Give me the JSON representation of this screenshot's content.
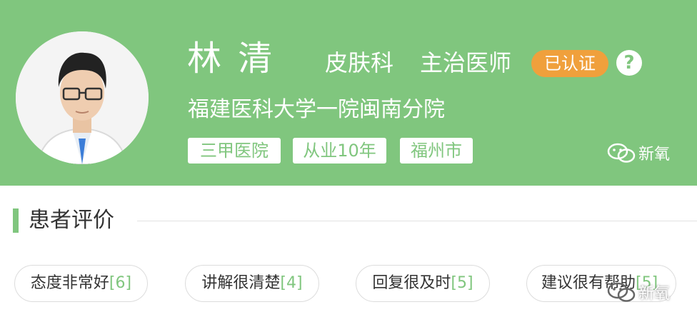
{
  "doctor": {
    "name": "林  清",
    "department": "皮肤科",
    "title": "主治医师",
    "verified_label": "已认证",
    "help_label": "?",
    "hospital": "福建医科大学一院闽南分院",
    "tags": [
      "三甲医院",
      "从业10年",
      "福州市"
    ]
  },
  "watermark": {
    "text": "新氧",
    "icon": "wechat-icon"
  },
  "reviews": {
    "section_title": "患者评价",
    "chips": [
      {
        "label": "态度非常好",
        "count": "[6]"
      },
      {
        "label": "讲解很清楚",
        "count": "[4]"
      },
      {
        "label": "回复很及时",
        "count": "[5]"
      },
      {
        "label": "建议很有帮助",
        "count": "[5]"
      }
    ]
  },
  "colors": {
    "brand_green": "#80c67e",
    "badge_orange": "#f0a03c"
  }
}
